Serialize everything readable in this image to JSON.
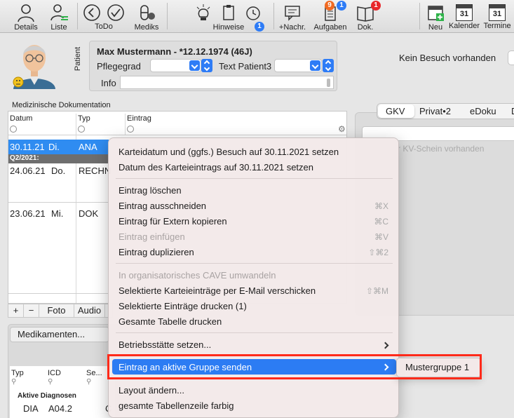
{
  "toolbar": {
    "details": "Details",
    "liste": "Liste",
    "todo": "ToDo",
    "mediks": "Mediks",
    "hinweise": "Hinweise",
    "hinweise_badge": "1",
    "nachr": "+Nachr.",
    "aufgaben": "Aufgaben",
    "aufgaben_badge_orange": "9",
    "aufgaben_badge_blue": "1",
    "dok": "Dok.",
    "dok_badge": "1",
    "neu": "Neu",
    "kalender": "Kalender",
    "kalender_day": "31",
    "termine": "Termine",
    "termine_day": "31"
  },
  "patient": {
    "side_label": "Patient",
    "name": "Max Mustermann - *12.12.1974 (46J)",
    "pflegegrad_label": "Pflegegrad",
    "text_patient_label": "Text Patient3",
    "info_label": "Info",
    "visit_status": "Kein Besuch vorhanden"
  },
  "documentation": {
    "title": "Medizinische Dokumentation",
    "columns": [
      "Datum",
      "Typ",
      "Eintrag"
    ],
    "rows": [
      {
        "date": "30.11.21",
        "day": "Di.",
        "type": "ANA"
      },
      {
        "date": "24.06.21",
        "day": "Do.",
        "type": "RECHN"
      },
      {
        "date": "23.06.21",
        "day": "Mi.",
        "type": "DOK"
      }
    ],
    "quarter_label": "Q2/2021:",
    "footer": [
      "+",
      "−",
      "Foto",
      "Audio"
    ]
  },
  "right_panel": {
    "tabs": [
      "GKV",
      "Privat•2",
      "eDoku",
      "D"
    ],
    "kv_text": "r KV-Schein vorhanden"
  },
  "bottom": {
    "tab_label": "Medikamenten...",
    "columns": [
      "Typ",
      "ICD",
      "Se..."
    ],
    "group_label": "Aktive Diagnosen",
    "row": {
      "type": "DIA",
      "icd": "A04.2",
      "extra": "C"
    }
  },
  "context_menu": {
    "items": [
      {
        "label": "Karteidatum und (ggfs.) Besuch auf 30.11.2021 setzen",
        "shortcut": "",
        "disabled": false
      },
      {
        "label": "Datum des Karteieintrags auf 30.11.2021 setzen",
        "shortcut": "",
        "disabled": false
      },
      {
        "label": "Eintrag löschen",
        "shortcut": "",
        "disabled": false
      },
      {
        "label": "Eintrag ausschneiden",
        "shortcut": "⌘X",
        "disabled": false
      },
      {
        "label": "Eintrag für Extern kopieren",
        "shortcut": "⌘C",
        "disabled": false
      },
      {
        "label": "Eintrag einfügen",
        "shortcut": "⌘V",
        "disabled": true
      },
      {
        "label": "Eintrag duplizieren",
        "shortcut": "⇧⌘2",
        "disabled": false
      },
      {
        "label": "In organisatorisches CAVE umwandeln",
        "shortcut": "",
        "disabled": true
      },
      {
        "label": "Selektierte Karteieinträge per E-Mail verschicken",
        "shortcut": "⇧⌘M",
        "disabled": false
      },
      {
        "label": "Selektierte Einträge drucken (1)",
        "shortcut": "",
        "disabled": false
      },
      {
        "label": "Gesamte Tabelle drucken",
        "shortcut": "",
        "disabled": false
      },
      {
        "label": "Betriebsstätte setzen...",
        "shortcut": "",
        "disabled": false
      },
      {
        "label": "Eintrag an aktive Gruppe senden",
        "shortcut": "",
        "disabled": false
      },
      {
        "label": "Layout ändern...",
        "shortcut": "",
        "disabled": false
      },
      {
        "label": "gesamte Tabellenzeile farbig",
        "shortcut": "",
        "disabled": false
      }
    ],
    "submenu_item": "Mustergruppe 1"
  },
  "colors": {
    "selection_blue": "#2c7cf3",
    "highlight_red": "#ff2a1a",
    "badge_red": "#e8262a",
    "badge_orange": "#f06a22",
    "badge_blue": "#2e7cf6",
    "toolbar_green": "#2fb34a"
  }
}
